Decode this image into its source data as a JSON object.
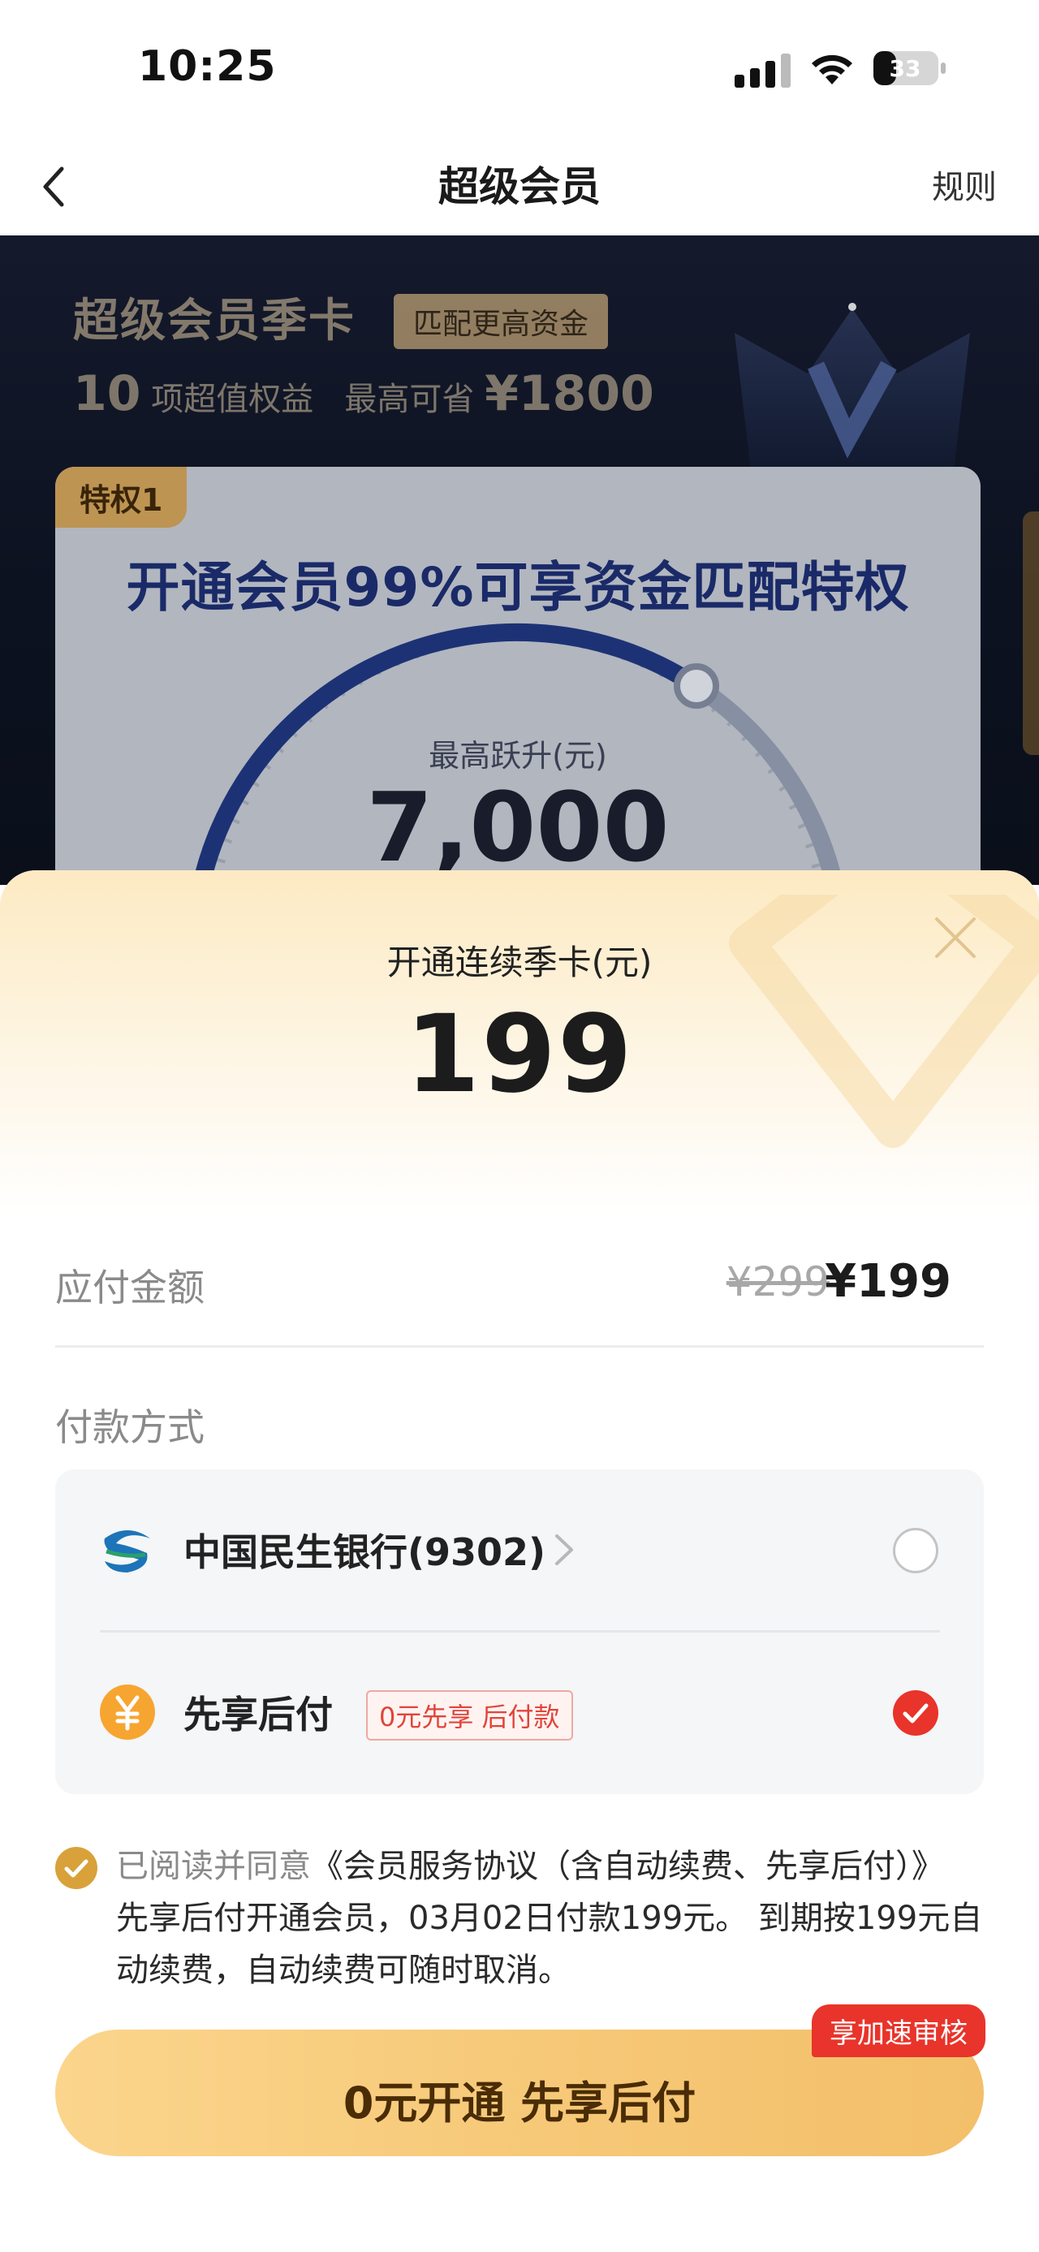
{
  "status_bar": {
    "time": "10:25",
    "battery": "33"
  },
  "nav": {
    "title": "超级会员",
    "rules_label": "规则"
  },
  "banner": {
    "title": "超级会员季卡",
    "tag": "匹配更高资金",
    "sub_count": "10",
    "sub_text_1": "项超值权益",
    "sub_text_2": "最高可省",
    "sub_amount": "¥1800",
    "card_tag": "特权1",
    "card_headline": "开通会员99%可享资金匹配特权",
    "gauge_label": "最高跃升(元)",
    "gauge_value": "7,000"
  },
  "sheet": {
    "plan_label": "开通连续季卡(元)",
    "price": "199",
    "amount_label": "应付金额",
    "amount_old": "¥299",
    "amount_new": "¥199",
    "payment_title": "付款方式",
    "methods": [
      {
        "name": "中国民生银行(9302)",
        "selected": false
      },
      {
        "name": "先享后付",
        "badge": "0元先享 后付款",
        "selected": true
      }
    ],
    "agreement_prefix": "已阅读并同意",
    "agreement_link": "《会员服务协议（含自动续费、先享后付）》",
    "agreement_line_2": "先享后付开通会员，03月02日付款199元。 到期按199元自",
    "agreement_line_3": "动续费，自动续费可随时取消。",
    "cta_label": "0元开通 先享后付",
    "cta_badge": "享加速审核"
  },
  "colors": {
    "accent_gold": "#f6c877",
    "badge_red": "#e8342b",
    "check_red": "#e8342b",
    "agree_gold": "#d9a13a"
  }
}
